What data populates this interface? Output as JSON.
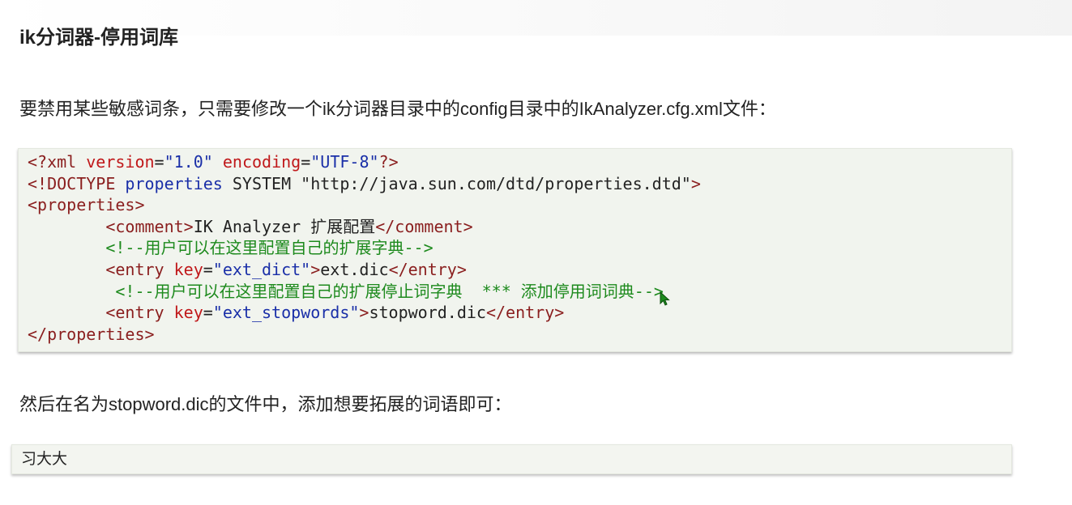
{
  "heading": "ik分词器-停用词库",
  "intro_text": "要禁用某些敏感词条，只需要修改一个ik分词器目录中的config目录中的IkAnalyzer.cfg.xml文件：",
  "code": {
    "l1_open": "<?xml ",
    "l1_attr1": "version",
    "l1_eq1": "=",
    "l1_val1": "\"1.0\"",
    "l1_sp": " ",
    "l1_attr2": "encoding",
    "l1_eq2": "=",
    "l1_val2": "\"UTF-8\"",
    "l1_close": "?>",
    "l2_open": "<!DOCTYPE ",
    "l2_kw": "properties",
    "l2_rest": " SYSTEM \"http://java.sun.com/dtd/properties.dtd\"",
    "l2_close": ">",
    "l3_tag": "<properties>",
    "l4_indent": "        ",
    "l4_open": "<comment>",
    "l4_text": "IK Analyzer 扩展配置",
    "l4_close": "</comment>",
    "l5_indent": "        ",
    "l5_comment": "<!--用户可以在这里配置自己的扩展字典-->",
    "l6_indent": "        ",
    "l6_open": "<entry ",
    "l6_attr": "key",
    "l6_eq": "=",
    "l6_val": "\"ext_dict\"",
    "l6_gt": ">",
    "l6_text": "ext.dic",
    "l6_close": "</entry>",
    "l7_indent": "         ",
    "l7_comment": "<!--用户可以在这里配置自己的扩展停止词字典  *** 添加停用词词典-->",
    "l8_indent": "        ",
    "l8_open": "<entry ",
    "l8_attr": "key",
    "l8_eq": "=",
    "l8_val": "\"ext_stopwords\"",
    "l8_gt": ">",
    "l8_text": "stopword.dic",
    "l8_close": "</entry>",
    "l9_tag": "</properties>"
  },
  "followup_text": "然后在名为stopword.dic的文件中，添加想要拓展的词语即可：",
  "stopword_example": "习大大",
  "colors": {
    "tag": "#8a1e1e",
    "attribute": "#c0181a",
    "value": "#1a2fa8",
    "comment": "#1d8a1d",
    "code_background": "#f1f4ee"
  },
  "icons": {
    "cursor": "mouse-pointer-icon"
  }
}
